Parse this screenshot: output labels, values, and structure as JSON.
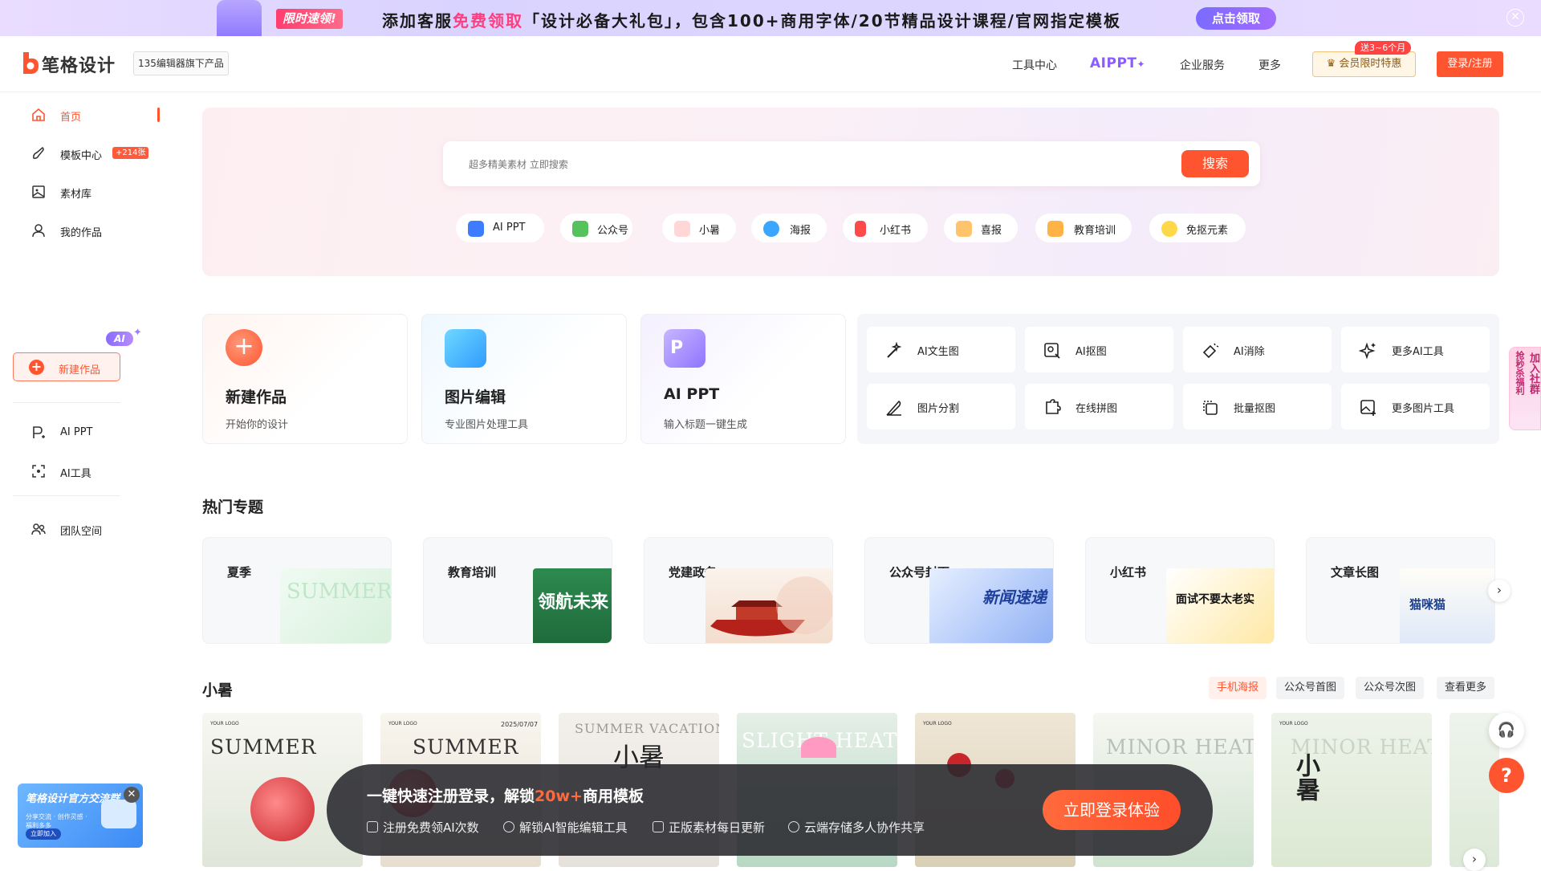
{
  "promo": {
    "limited_tag": "限时速领!",
    "text_before": "添加客服",
    "text_highlight": "免费领取",
    "text_after": "「设计必备大礼包」，包含100+商用字体/20节精品设计课程/官网指定模板",
    "claim_button": "点击领取",
    "close_icon": "close-icon"
  },
  "header": {
    "logo_text": "笔格设计",
    "sub_brand": "135编辑器旗下产品",
    "nav": {
      "tools": "工具中心",
      "aippt": "AIPPT",
      "enterprise": "企业服务",
      "more": "更多"
    },
    "vip_tag": "送3~6个月",
    "vip_button": "会员限时特惠",
    "login_button": "登录/注册",
    "colors": {
      "brand": "#ff5430",
      "ai": "#8b5cff"
    }
  },
  "sidebar": {
    "items": [
      {
        "label": "首页",
        "icon": "home-icon"
      },
      {
        "label": "模板中心",
        "icon": "brush-icon",
        "badge": "+214张"
      },
      {
        "label": "素材库",
        "icon": "image-icon"
      },
      {
        "label": "我的作品",
        "icon": "user-icon"
      }
    ],
    "new_button": "新建作品",
    "ai_items": [
      {
        "label": "AI PPT",
        "icon": "ppt-icon",
        "badge": "AI"
      },
      {
        "label": "AI工具",
        "icon": "scan-icon"
      }
    ],
    "team": {
      "label": "团队空间",
      "icon": "team-icon"
    },
    "community": {
      "title": "笔格设计官方交流群",
      "desc": "分享交流 · 创作灵感 · 福利多多",
      "join": "立即加入"
    }
  },
  "hero": {
    "search_placeholder": "超多精美素材 立即搜索",
    "search_button": "搜索",
    "chips": [
      "AI PPT",
      "公众号",
      "小暑",
      "海报",
      "小红书",
      "喜报",
      "教育培训",
      "免抠元素"
    ]
  },
  "features": [
    {
      "title": "新建作品",
      "subtitle": "开始你的设计"
    },
    {
      "title": "图片编辑",
      "subtitle": "专业图片处理工具"
    },
    {
      "title": "AI PPT",
      "subtitle": "输入标题一键生成"
    }
  ],
  "tools": [
    "AI文生图",
    "AI抠图",
    "AI消除",
    "更多AI工具",
    "图片分割",
    "在线拼图",
    "批量抠图",
    "更多图片工具"
  ],
  "hot_topics": {
    "title": "热门专题",
    "items": [
      "夏季",
      "教育培训",
      "党建政务",
      "公众号封面",
      "小红书",
      "文章长图"
    ],
    "image_texts": [
      "SUMMER",
      "领航未来",
      "新闻速递",
      "面试不要太老实",
      "猫咪猫"
    ]
  },
  "section2": {
    "title": "小暑",
    "tabs": [
      "手机海报",
      "公众号首图",
      "公众号次图",
      "查看更多"
    ]
  },
  "posters": [
    {
      "logo": "YOUR LOGO",
      "title": "SUMMER"
    },
    {
      "logo": "YOUR LOGO",
      "title": "SUMMER",
      "date": "2025/07/07"
    },
    {
      "logo": "",
      "title": "SUMMER VACATION",
      "sub": "小暑"
    },
    {
      "logo": "",
      "title": "SLIGHT HEAT"
    },
    {
      "logo": "YOUR LOGO",
      "title": ""
    },
    {
      "logo": "",
      "title": "MINOR HEAT"
    },
    {
      "logo": "YOUR LOGO",
      "title": "MINOR HEAT",
      "sub": "小暑"
    }
  ],
  "login_bar": {
    "headline_before": "一键快速注册登录，解锁",
    "headline_num": "20w+",
    "headline_after": "商用模板",
    "perks": [
      "注册免费领AI次数",
      "解锁AI智能编辑工具",
      "正版素材每日更新",
      "云端存储多人协作共享"
    ],
    "cta": "立即登录体验"
  },
  "floating": {
    "group_label": "加入社群",
    "group_sub": "抢秒杀福利",
    "support_icon": "headset-icon",
    "help": "?"
  }
}
